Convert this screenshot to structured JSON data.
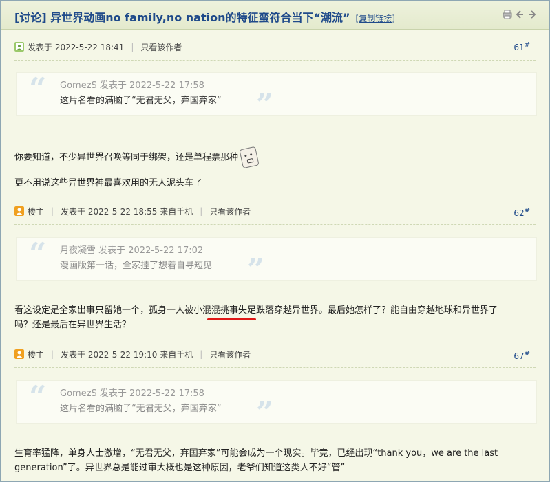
{
  "thread": {
    "title": "[讨论] 异世界动画no family,no nation的特征蛮符合当下“潮流”",
    "copy_link": "[复制链接]"
  },
  "toolbar_icons": [
    "print-icon",
    "prev-arrow-icon",
    "next-arrow-icon"
  ],
  "posts": [
    {
      "author_badge": "",
      "posted": "发表于 2022-5-22 18:41",
      "only_author": "只看该作者",
      "floor": "61",
      "floor_mark": "#",
      "quote": {
        "meta": "GomezS 发表于 2022-5-22 17:58",
        "text": "这片名看的满脑子“无君无父，弃国弃家”"
      },
      "lines": [
        "你要知道，不少异世界召唤等同于绑架，还是单程票那种",
        "更不用说这些异世界神最喜欢用的无人泥头车了"
      ]
    },
    {
      "author_badge": "楼主",
      "posted": "发表于 2022-5-22 18:55 来自手机",
      "only_author": "只看该作者",
      "floor": "62",
      "floor_mark": "#",
      "quote": {
        "meta": "月夜凝雪 发表于 2022-5-22 17:02",
        "text": "漫画版第一话，全家挂了想着自寻短见"
      },
      "lines": [
        "看这设定是全家出事只留她一个，孤身一人被小混混挑事失足跌落穿越异世界。最后她怎样了？能自由穿越地球和异世界了",
        "吗？还是最后在异世界生活？"
      ]
    },
    {
      "author_badge": "楼主",
      "posted": "发表于 2022-5-22 19:10 来自手机",
      "only_author": "只看该作者",
      "floor": "67",
      "floor_mark": "#",
      "quote": {
        "meta": "GomezS 发表于 2022-5-22 17:58",
        "text": "这片名看的满脑子“无君无父，弃国弃家”"
      },
      "lines": [
        "生育率猛降，单身人士激增，“无君无父，弃国弃家”可能会成为一个现实。毕竟，已经出现“thank you，we are the last",
        "generation”了。异世界总是能过审大概也是这种原因，老爷们知道这类人不好“管”"
      ]
    }
  ],
  "colors": {
    "title": "#1f4a8a",
    "background": "#f5f7e7",
    "underline": "#e01818"
  }
}
